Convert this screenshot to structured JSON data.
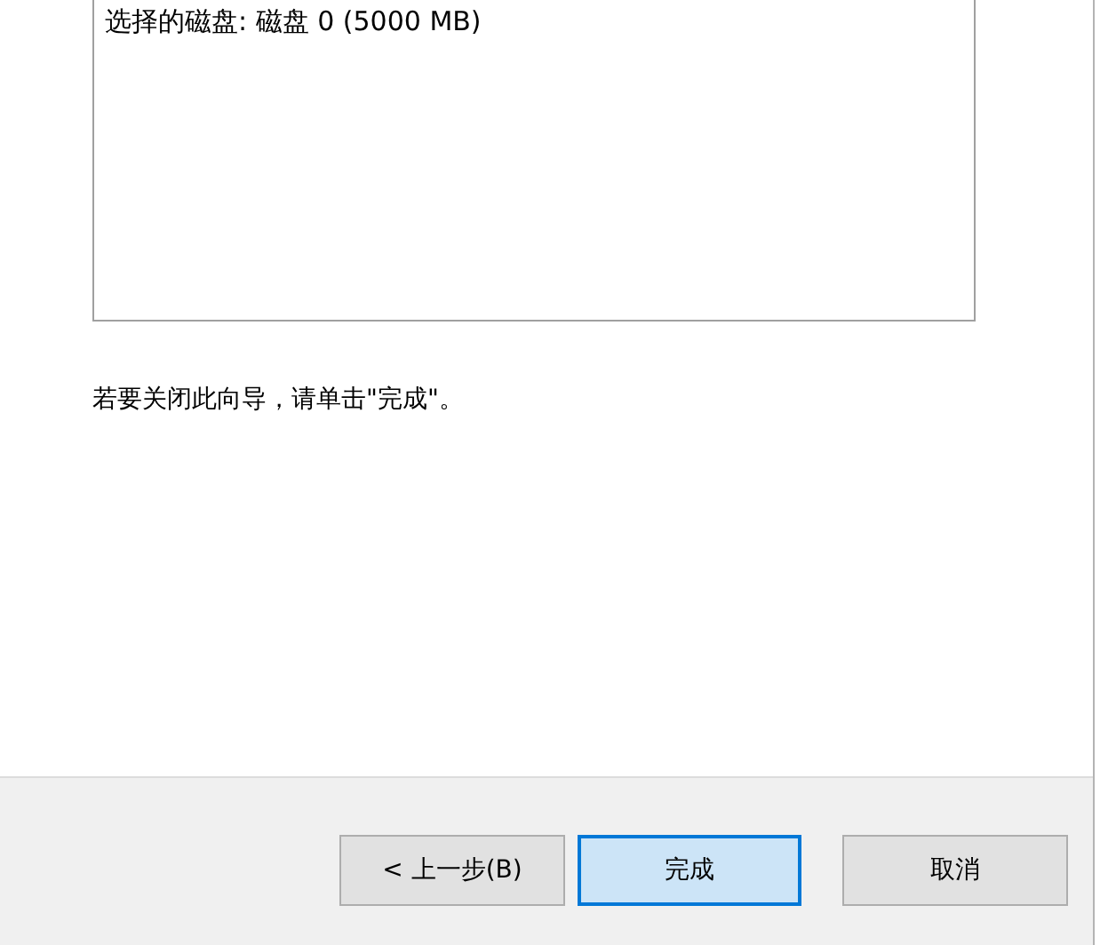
{
  "summary": {
    "text": "选择的磁盘: 磁盘 0 (5000 MB)"
  },
  "instruction": "若要关闭此向导，请单击\"完成\"。",
  "buttons": [
    {
      "label": "< 上一步(B)",
      "focused": false
    },
    {
      "label": "完成",
      "focused": true
    },
    {
      "label": "取消",
      "focused": false
    }
  ]
}
